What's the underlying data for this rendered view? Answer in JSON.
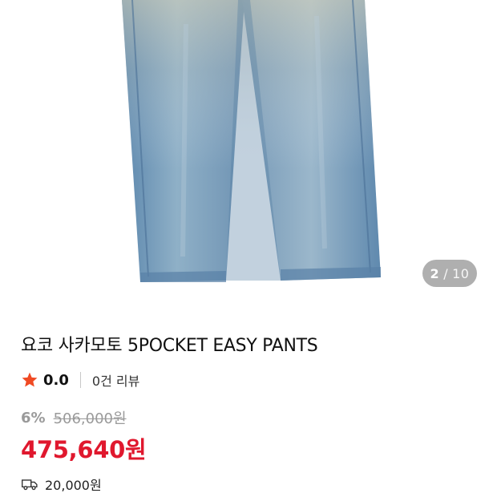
{
  "gallery": {
    "current": "2",
    "separator": "/",
    "total": "10"
  },
  "product": {
    "title": "요코 사카모토 5POCKET EASY PANTS",
    "rating": "0.0",
    "review_count_label": "0건 리뷰",
    "discount_rate": "6%",
    "original_price": "506,000원",
    "sale_price": "475,640원",
    "shipping_fee": "20,000원"
  },
  "icons": {
    "rating": "star-icon",
    "shipping": "truck-icon"
  },
  "colors": {
    "accent": "#e0182e",
    "star": "#f04a23",
    "muted": "#9a9a9a"
  }
}
